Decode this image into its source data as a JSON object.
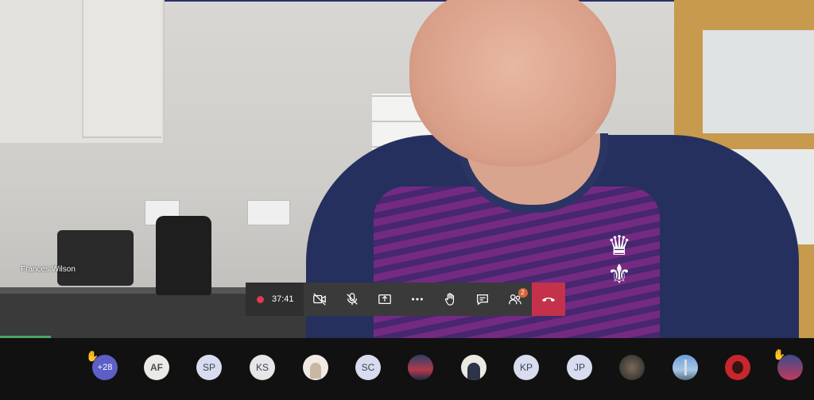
{
  "speaker": {
    "name": "Frances Wilson"
  },
  "call_controls": {
    "recording_time": "37:41",
    "buttons": [
      {
        "name": "camera-off-button",
        "icon": "video-off-icon"
      },
      {
        "name": "mic-off-button",
        "icon": "mic-off-icon"
      },
      {
        "name": "share-button",
        "icon": "share-icon"
      },
      {
        "name": "more-button",
        "icon": "more-icon"
      },
      {
        "name": "raise-hand-button",
        "icon": "hand-icon"
      },
      {
        "name": "chat-button",
        "icon": "chat-icon"
      },
      {
        "name": "participants-button",
        "icon": "people-icon",
        "badge": "2"
      }
    ],
    "hangup_color": "#c4314b"
  },
  "participants": {
    "overflow_label": "+28",
    "list": [
      {
        "initials": "AF"
      },
      {
        "initials": "SP"
      },
      {
        "initials": "KS"
      },
      {
        "initials": ""
      },
      {
        "initials": "SC"
      },
      {
        "initials": ""
      },
      {
        "initials": ""
      },
      {
        "initials": "KP"
      },
      {
        "initials": "JP"
      },
      {
        "initials": ""
      },
      {
        "initials": ""
      },
      {
        "initials": ""
      },
      {
        "initials": ""
      }
    ]
  },
  "colors": {
    "accent": "#5b5fc7",
    "recording": "#e03a4e",
    "badge": "#d2683a"
  }
}
